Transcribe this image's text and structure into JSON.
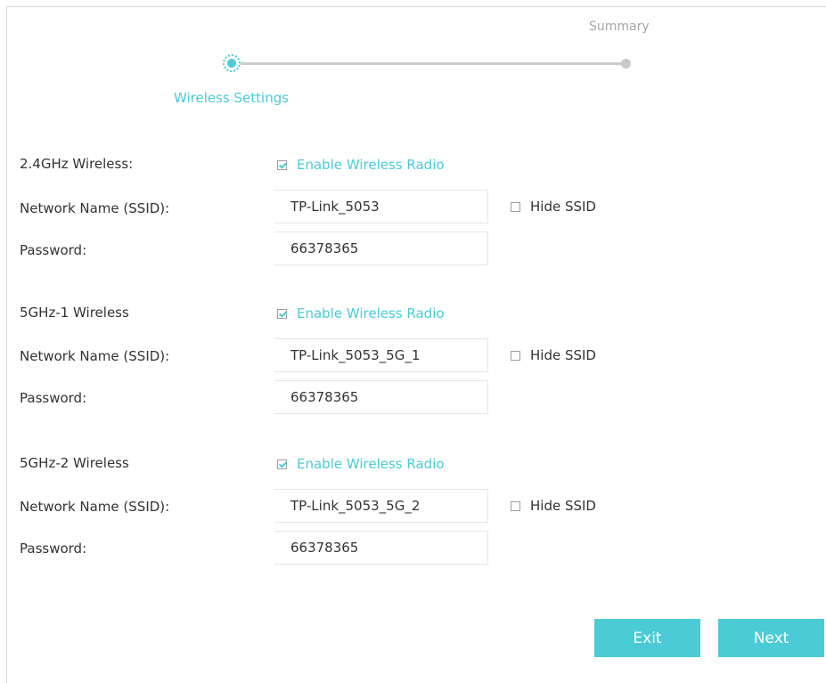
{
  "stepper": {
    "active_label": "Wireless Settings",
    "summary_label": "Summary"
  },
  "sections": [
    {
      "title": "2.4GHz Wireless:",
      "enable_label": "Enable Wireless Radio",
      "enabled": true,
      "ssid_label": "Network Name (SSID):",
      "ssid_value": "TP-Link_5053",
      "hide_label": "Hide SSID",
      "hide_checked": false,
      "password_label": "Password:",
      "password_value": "66378365"
    },
    {
      "title": "5GHz-1 Wireless",
      "enable_label": "Enable Wireless Radio",
      "enabled": true,
      "ssid_label": "Network Name (SSID):",
      "ssid_value": "TP-Link_5053_5G_1",
      "hide_label": "Hide SSID",
      "hide_checked": false,
      "password_label": "Password:",
      "password_value": "66378365"
    },
    {
      "title": "5GHz-2 Wireless",
      "enable_label": "Enable Wireless Radio",
      "enabled": true,
      "ssid_label": "Network Name (SSID):",
      "ssid_value": "TP-Link_5053_5G_2",
      "hide_label": "Hide SSID",
      "hide_checked": false,
      "password_label": "Password:",
      "password_value": "66378365"
    }
  ],
  "buttons": {
    "exit": "Exit",
    "next": "Next"
  },
  "colors": {
    "accent": "#4acbd6",
    "track": "#cccccc",
    "muted_text": "#a6a6a6"
  }
}
